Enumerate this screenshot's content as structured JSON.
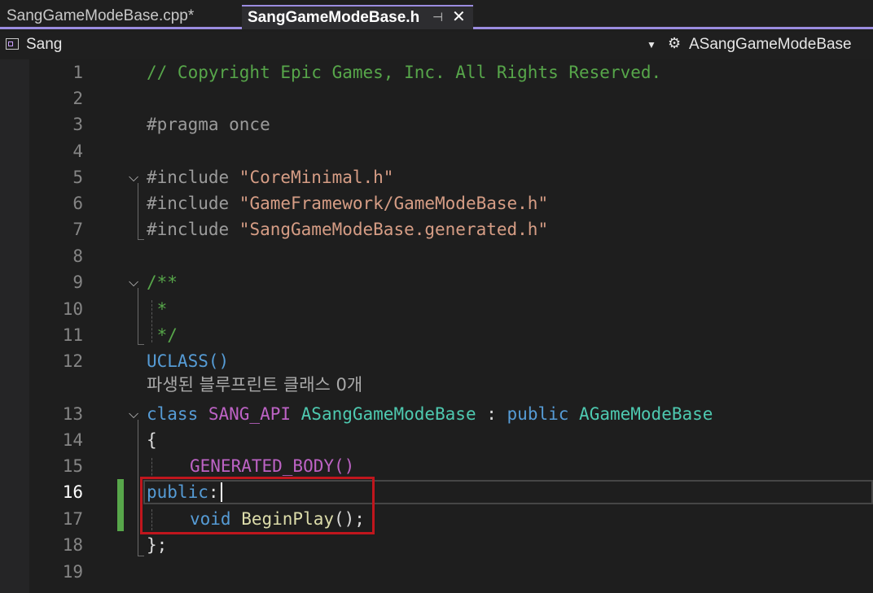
{
  "tabs": [
    {
      "label": "SangGameModeBase.cpp*",
      "active": false
    },
    {
      "label": "SangGameModeBase.h",
      "active": true
    }
  ],
  "tab_icons": {
    "pin": "pin-icon",
    "close": "close-icon"
  },
  "navbar": {
    "project": "Sang",
    "class_scope": "ASangGameModeBase"
  },
  "editor": {
    "current_line": "16",
    "line_numbers": [
      "1",
      "2",
      "3",
      "4",
      "5",
      "6",
      "7",
      "8",
      "9",
      "10",
      "11",
      "12",
      "13",
      "14",
      "15",
      "16",
      "17",
      "18",
      "19"
    ],
    "codelens": "파생된 블루프린트 클래스 0개",
    "code": {
      "l1": "// Copyright Epic Games, Inc. All Rights Reserved.",
      "l3": "#pragma once",
      "l5_pre": "#include ",
      "l5_str": "\"CoreMinimal.h\"",
      "l6_pre": "#include ",
      "l6_str": "\"GameFramework/GameModeBase.h\"",
      "l7_pre": "#include ",
      "l7_str": "\"SangGameModeBase.generated.h\"",
      "l9": "/**",
      "l10": " *",
      "l11": " */",
      "l12": "UCLASS()",
      "l13_kw": "class ",
      "l13_api": "SANG_API ",
      "l13_type": "ASangGameModeBase",
      "l13_colon": " : ",
      "l13_pub": "public ",
      "l13_base": "AGameModeBase",
      "l14": "{",
      "l15": "GENERATED_BODY()",
      "l16_kw": "public",
      "l16_colon": ":",
      "l17_kw": "void ",
      "l17_fn": "BeginPlay",
      "l17_rest": "();",
      "l18": "};"
    }
  },
  "colors": {
    "accent": "#9b8ce0",
    "change_bar": "#57a64a",
    "highlight_box": "#c0161d",
    "background": "#1e1e1e"
  }
}
